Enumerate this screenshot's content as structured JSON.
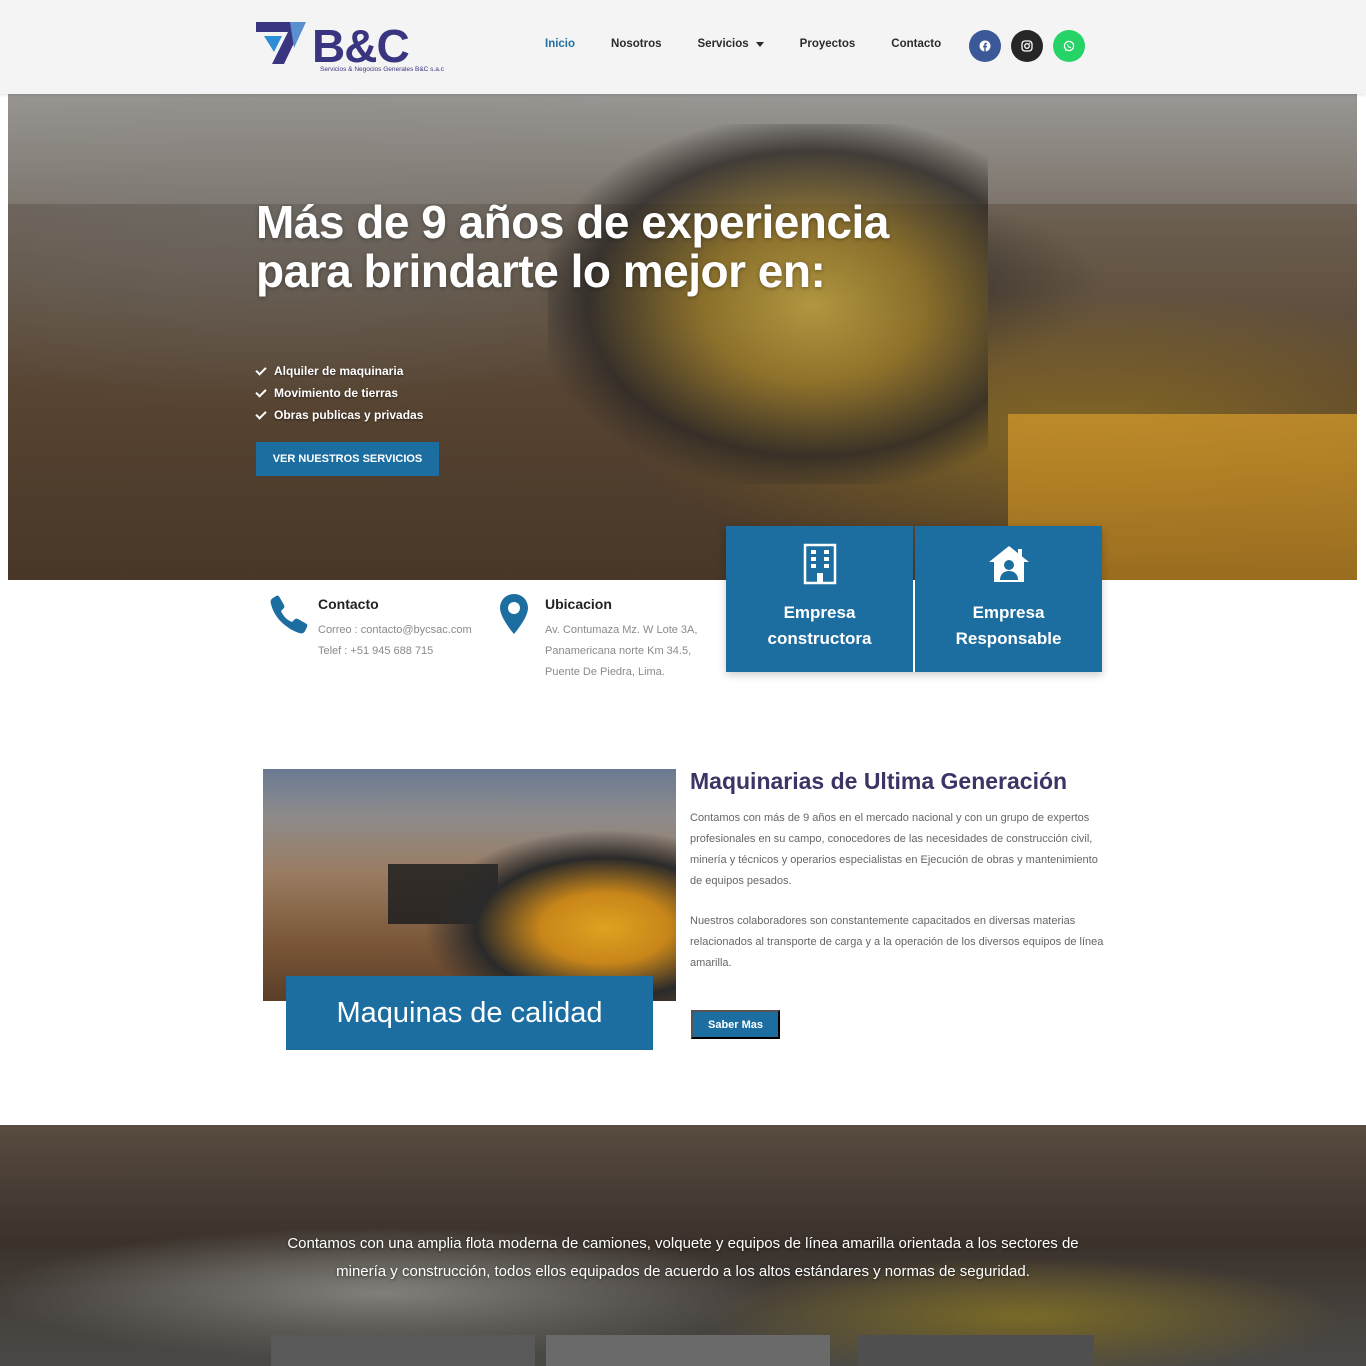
{
  "header": {
    "logo_text": "B&C",
    "logo_tagline": "Servicios & Negocios Generales B&C s.a.c",
    "nav": [
      {
        "label": "Inicio"
      },
      {
        "label": "Nosotros"
      },
      {
        "label": "Servicios"
      },
      {
        "label": "Proyectos"
      },
      {
        "label": "Contacto"
      }
    ],
    "socials": [
      "facebook-icon",
      "instagram-icon",
      "whatsapp-icon"
    ],
    "colors": {
      "accent": "#1d6ea0",
      "logo_blue": "#3a3580",
      "facebook": "#3b5998",
      "instagram": "#262626",
      "whatsapp": "#25d366"
    }
  },
  "hero": {
    "title": "Más de 9 años de experiencia para brindarte lo mejor en:",
    "list": [
      "Alquiler de maquinaria",
      "Movimiento de tierras",
      "Obras publicas y privadas"
    ],
    "cta": "VER NUESTROS SERVICIOS"
  },
  "info": {
    "contact": {
      "title": "Contacto",
      "email": "Correo : contacto@bycsac.com",
      "phone": "Telef : +51 945 688 715"
    },
    "location": {
      "title": "Ubicacion",
      "lines": [
        "Av. Contumaza Mz. W Lote 3A,",
        "Panamericana norte Km 34.5,",
        "Puente De Piedra, Lima."
      ]
    }
  },
  "cards": [
    {
      "label_line1": "Empresa",
      "label_line2": "constructora",
      "icon": "building-icon"
    },
    {
      "label_line1": "Empresa",
      "label_line2": "Responsable",
      "icon": "house-user-icon"
    }
  ],
  "section2": {
    "badge": "Maquinas de calidad",
    "title": "Maquinarias de Ultima Generación",
    "para1": "Contamos con más de 9 años en el mercado nacional y con un grupo de expertos profesionales en su campo, conocedores de las necesidades de construcción civil, minería y técnicos y operarios especialistas en Ejecución de obras y mantenimiento de equipos pesados.",
    "para2": "Nuestros colaboradores son constantemente capacitados en diversas materias relacionados al transporte de carga y a la operación de los diversos equipos de línea amarilla.",
    "button": "Saber Mas"
  },
  "band": {
    "text": "Contamos con una amplia flota moderna de camiones, volquete y equipos de línea amarilla orientada a los sectores de minería y construcción, todos ellos equipados de acuerdo a los altos estándares y normas de seguridad."
  }
}
